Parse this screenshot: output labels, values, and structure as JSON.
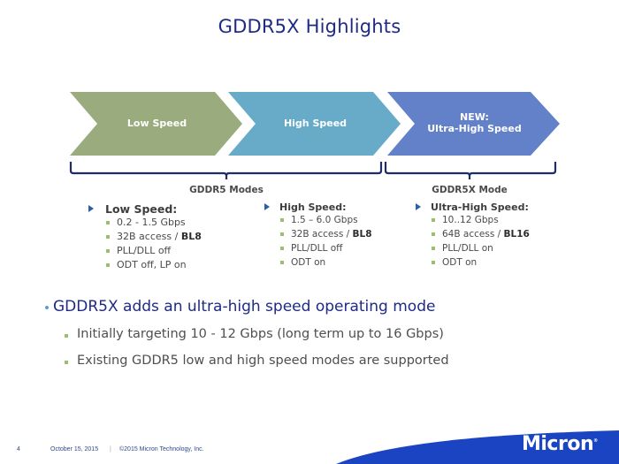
{
  "slide": {
    "title": "GDDR5X Highlights",
    "chevrons": [
      {
        "label_line1": "Low Speed",
        "label_line2": "",
        "color": "#9aac7e"
      },
      {
        "label_line1": "High Speed",
        "label_line2": "",
        "color": "#67abc9"
      },
      {
        "label_line1": "NEW:",
        "label_line2": "Ultra-High Speed",
        "color": "#6381c9"
      }
    ],
    "groups": [
      {
        "label": "GDDR5 Modes"
      },
      {
        "label": "GDDR5X Mode"
      }
    ],
    "modes": [
      {
        "heading": "Low Speed:",
        "items": [
          {
            "text": "0.2 - 1.5 Gbps",
            "bold": ""
          },
          {
            "text": "32B access / ",
            "bold": "BL8"
          },
          {
            "text": "PLL/DLL off",
            "bold": ""
          },
          {
            "text": "ODT off, LP on",
            "bold": ""
          }
        ]
      },
      {
        "heading": "High Speed:",
        "items": [
          {
            "text": "1.5 – 6.0 Gbps",
            "bold": ""
          },
          {
            "text": "32B access / ",
            "bold": "BL8"
          },
          {
            "text": "PLL/DLL off",
            "bold": ""
          },
          {
            "text": "ODT on",
            "bold": ""
          }
        ]
      },
      {
        "heading": "Ultra-High Speed:",
        "items": [
          {
            "text": "10..12 Gbps",
            "bold": ""
          },
          {
            "text": "64B access / ",
            "bold": "BL16"
          },
          {
            "text": "PLL/DLL on",
            "bold": ""
          },
          {
            "text": "ODT on",
            "bold": ""
          }
        ]
      }
    ],
    "main_bullet": "GDDR5X adds an ultra-high speed operating mode",
    "sub_bullets": [
      "Initially targeting  10 - 12 Gbps (long term up to 16 Gbps)",
      "Existing GDDR5 low and high speed modes are supported"
    ]
  },
  "footer": {
    "page_number": "4",
    "date": "October 15, 2015",
    "separator": "|",
    "copyright": "©2015 Micron Technology, Inc.",
    "logo_text": "Micron",
    "logo_mark": "®",
    "brand_color": "#1a44c2"
  }
}
